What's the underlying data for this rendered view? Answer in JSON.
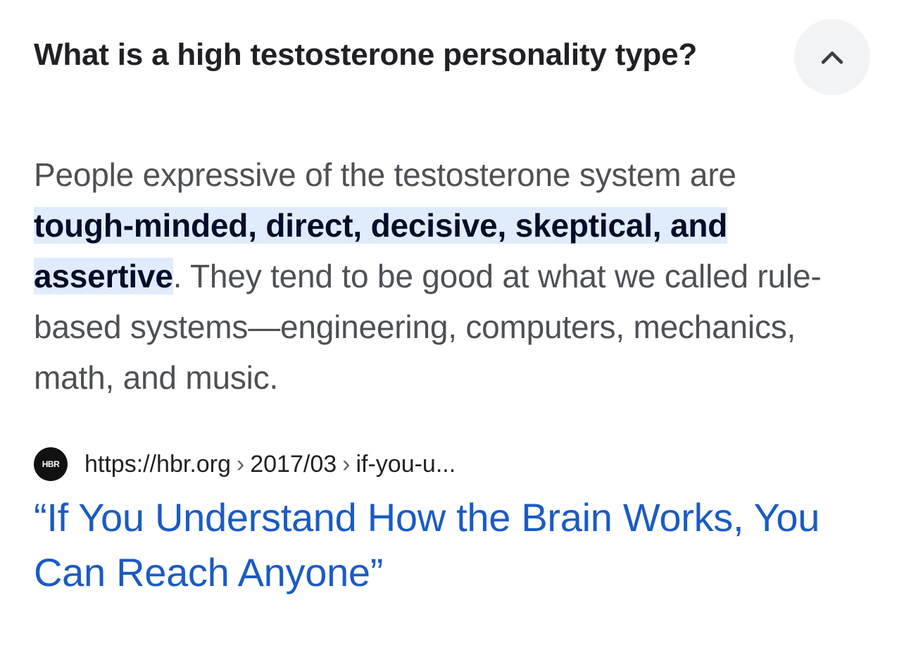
{
  "question": {
    "text": "What is a high testosterone personality type?",
    "toggle_icon": "chevron-up-icon"
  },
  "answer": {
    "lead": "People expressive of the testosterone system are ",
    "highlight": "tough-minded, direct, decisive, skeptical, and assertive",
    "rest": ". They tend to be good at what we called rule-based systems—engineering, computers, mechanics, math, and music."
  },
  "source": {
    "favicon_label": "HBR",
    "domain": "https://hbr.org",
    "path_1": "2017/03",
    "path_2": "if-you-u...",
    "separator": "›"
  },
  "result": {
    "title": "“If You Understand How the Brain Works, You Can Reach Anyone”"
  },
  "colors": {
    "highlight_bg": "#e0ecfc",
    "link": "#1a5bc4",
    "text": "#4d5156",
    "heading": "#202124"
  }
}
